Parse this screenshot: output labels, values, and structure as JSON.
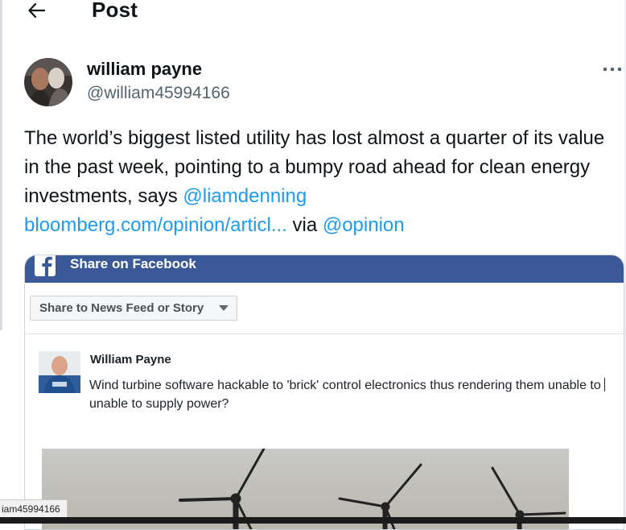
{
  "header": {
    "title": "Post",
    "back_icon": "arrow-left-icon"
  },
  "author": {
    "name": "william payne",
    "handle": "@william45994166",
    "more_icon": "more-horizontal-icon"
  },
  "tweet": {
    "text_before": "The world’s biggest listed utility has lost almost a quarter of its value in the past week, pointing to a bumpy road ahead for clean energy investments, says ",
    "mention1": "@liamdenning",
    "url": "bloomberg.com/opinion/articl...",
    "via_text": " via ",
    "mention2": "@opinion"
  },
  "card": {
    "bar_title": "Share on Facebook",
    "bar_color": "#3b5998",
    "share_select": "Share to News Feed or Story",
    "user_name": "William Payne",
    "text_part1": "Wind turbine software hackable to 'brick' control electronics thus rendering them unable to ",
    "text_part2": "unable to supply power?"
  },
  "status_bar": {
    "text": "iam45994166"
  },
  "colors": {
    "link": "#1d9bf0",
    "handle": "#536471",
    "text": "#0f1419"
  }
}
